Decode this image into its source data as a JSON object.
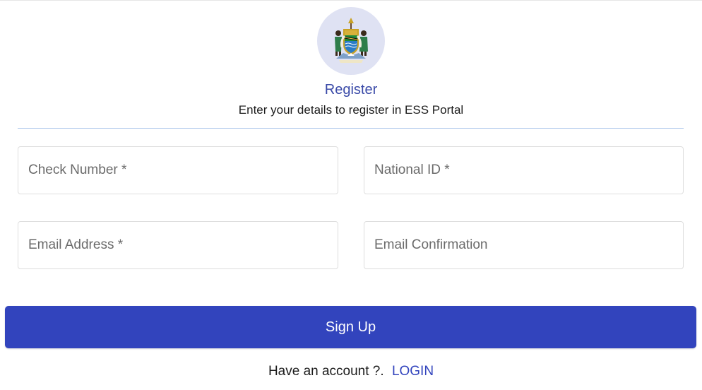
{
  "header": {
    "logo_icon": "coat-of-arms-emblem",
    "title": "Register",
    "subtitle": "Enter your details to register in ESS Portal"
  },
  "form": {
    "check_number": {
      "placeholder": "Check Number *",
      "value": ""
    },
    "national_id": {
      "placeholder": "National ID *",
      "value": ""
    },
    "email": {
      "placeholder": "Email Address *",
      "value": ""
    },
    "email_confirmation": {
      "placeholder": "Email Confirmation",
      "value": ""
    }
  },
  "actions": {
    "signup_label": "Sign Up"
  },
  "footer": {
    "prompt": "Have an account ?.",
    "login_label": "LOGIN"
  },
  "colors": {
    "primary": "#3244bd",
    "title": "#3a4aa8",
    "divider": "#a9c3ea",
    "logo_bg": "#dfe2f3"
  }
}
